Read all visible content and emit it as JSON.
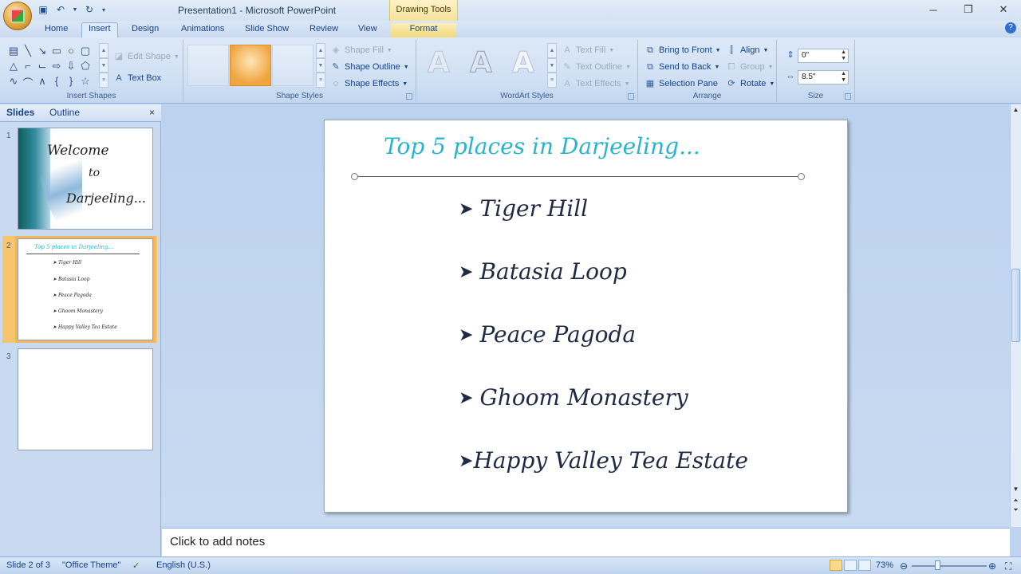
{
  "window": {
    "title": "Presentation1 - Microsoft PowerPoint",
    "context_tab_group": "Drawing Tools"
  },
  "tabs": [
    "Home",
    "Insert",
    "Design",
    "Animations",
    "Slide Show",
    "Review",
    "View",
    "Format"
  ],
  "active_tab": "Insert",
  "ribbon": {
    "insert_shapes": {
      "label": "Insert Shapes",
      "edit_shape": "Edit Shape",
      "text_box": "Text Box"
    },
    "shape_styles": {
      "label": "Shape Styles",
      "shape_fill": "Shape Fill",
      "shape_outline": "Shape Outline",
      "shape_effects": "Shape Effects"
    },
    "wordart_styles": {
      "label": "WordArt Styles",
      "text_fill": "Text Fill",
      "text_outline": "Text Outline",
      "text_effects": "Text Effects"
    },
    "arrange": {
      "label": "Arrange",
      "bring_to_front": "Bring to Front",
      "send_to_back": "Send to Back",
      "selection_pane": "Selection Pane",
      "align": "Align",
      "group": "Group",
      "rotate": "Rotate"
    },
    "size": {
      "label": "Size",
      "height": "0\"",
      "width": "8.5\""
    }
  },
  "panel": {
    "tab_slides": "Slides",
    "tab_outline": "Outline",
    "close": "×"
  },
  "thumbnails": {
    "slide1": {
      "num": "1",
      "line1": "Welcome",
      "line2": "to",
      "line3": "Darjeeling..."
    },
    "slide2": {
      "num": "2",
      "title": "Top 5 places in Darjeeling...",
      "items": [
        "Tiger Hill",
        "Batasia Loop",
        "Peace Pagoda",
        "Ghoom Monastery",
        "Happy Valley Tea Estate"
      ]
    },
    "slide3": {
      "num": "3"
    }
  },
  "slide": {
    "title": "Top 5 places in Darjeeling...",
    "bullets": [
      "Tiger Hill",
      "Batasia Loop",
      "Peace Pagoda",
      "Ghoom Monastery",
      "Happy Valley Tea Estate"
    ]
  },
  "notes_placeholder": "Click to add notes",
  "status": {
    "slide_indicator": "Slide 2 of 3",
    "theme": "\"Office Theme\"",
    "language": "English (U.S.)",
    "zoom": "73%"
  },
  "colors": {
    "title_accent": "#2ab4cc",
    "ribbon_bg": "#cfdff3",
    "selection_orange": "#f4b65b"
  }
}
